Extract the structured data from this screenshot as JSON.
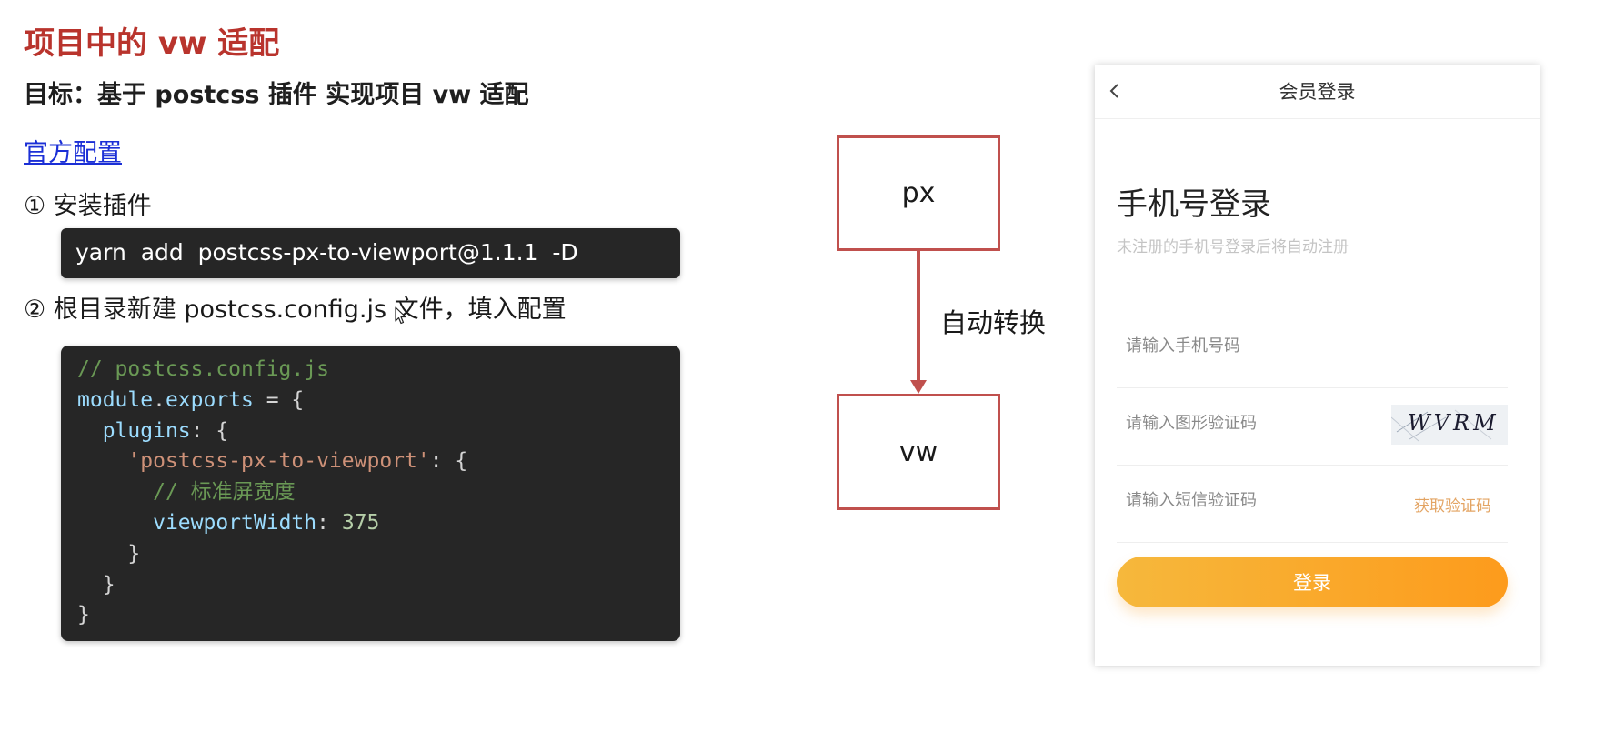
{
  "slide": {
    "title": "项目中的 vw 适配",
    "goal": "目标：基于 postcss 插件 实现项目 vw 适配",
    "doc_link": "官方配置",
    "step1": "① 安装插件",
    "install_command": "yarn  add  postcss-px-to-viewport@1.1.1  -D",
    "step2": "② 根目录新建 postcss.config.js 文件，填入配置"
  },
  "code": {
    "line1_comment": "// postcss.config.js",
    "line2_obj": "module",
    "line2_prop": "exports",
    "line3_prop": "plugins",
    "line4_str": "'postcss-px-to-viewport'",
    "line5_comment": "// 标准屏宽度",
    "line6_prop": "viewportWidth",
    "line6_num": "375"
  },
  "diagram": {
    "top_box": "px",
    "bottom_box": "vw",
    "arrow_label": "自动转换",
    "border_color": "#c0504d"
  },
  "phone": {
    "header_title": "会员登录",
    "back_icon": "chevron-left-icon",
    "heading": "手机号登录",
    "subheading": "未注册的手机号登录后将自动注册",
    "phone_placeholder": "请输入手机号码",
    "captcha_placeholder": "请输入图形验证码",
    "captcha_text": "WVRM",
    "sms_placeholder": "请输入短信验证码",
    "sms_link": "获取验证码",
    "login_button": "登录",
    "accent_color": "#fd9b1c"
  }
}
